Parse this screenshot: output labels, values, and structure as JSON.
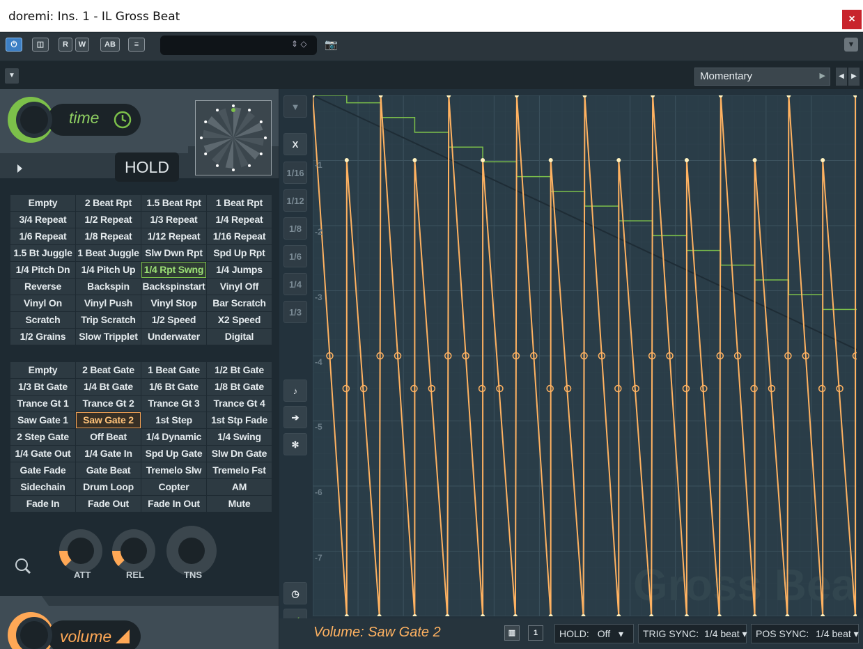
{
  "window": {
    "title": "doremi: Ins. 1 - IL Gross Beat",
    "close_glyph": "×"
  },
  "toolbar": {
    "buttons": [
      {
        "name": "power-button",
        "glyph": "⏻"
      },
      {
        "name": "window-button",
        "glyph": "◫"
      },
      {
        "name": "rec-button",
        "glyph": "R"
      },
      {
        "name": "wr-button",
        "glyph": "W"
      },
      {
        "name": "ab-button",
        "glyph": "AB"
      },
      {
        "name": "menu-button",
        "glyph": "≡"
      }
    ],
    "preset_value": "",
    "camera_glyph": "📷",
    "dropdown_glyph": "▼"
  },
  "subbar": {
    "dropdown_glyph": "▼",
    "mode": "Momentary",
    "prev": "◀",
    "next": "▶"
  },
  "time_panel": {
    "label": "time",
    "hold_label": "HOLD",
    "play_glyph": "▶"
  },
  "time_presets": [
    "Empty",
    "2 Beat Rpt",
    "1.5 Beat Rpt",
    "1 Beat Rpt",
    "3/4 Repeat",
    "1/2 Repeat",
    "1/3 Repeat",
    "1/4 Repeat",
    "1/6 Repeat",
    "1/8 Repeat",
    "1/12 Repeat",
    "1/16 Repeat",
    "1.5 Bt Juggle",
    "1 Beat Juggle",
    "Slw Dwn Rpt",
    "Spd Up Rpt",
    "1/4 Pitch Dn",
    "1/4 Pitch Up",
    "1/4 Rpt Swng",
    "1/4 Jumps",
    "Reverse",
    "Backspin",
    "Backspinstart",
    "Vinyl Off",
    "Vinyl On",
    "Vinyl Push",
    "Vinyl Stop",
    "Bar Scratch",
    "Scratch",
    "Trip Scratch",
    "1/2 Speed",
    "X2 Speed",
    "1/2 Grains",
    "Slow Tripplet",
    "Underwater",
    "Digital"
  ],
  "time_selected": "1/4 Rpt Swng",
  "volume_presets": [
    "Empty",
    "2 Beat Gate",
    "1 Beat Gate",
    "1/2 Bt Gate",
    "1/3 Bt Gate",
    "1/4 Bt Gate",
    "1/6 Bt Gate",
    "1/8 Bt Gate",
    "Trance Gt 1",
    "Trance Gt 2",
    "Trance Gt 3",
    "Trance Gt 4",
    "Saw Gate 1",
    "Saw Gate 2",
    "1st Step",
    "1st Stp Fade",
    "2 Step Gate",
    "Off Beat",
    "1/4 Dynamic",
    "1/4 Swing",
    "1/4 Gate Out",
    "1/4 Gate In",
    "Spd Up Gate",
    "Slw Dn Gate",
    "Gate Fade",
    "Gate Beat",
    "Tremelo Slw",
    "Tremelo Fst",
    "Sidechain",
    "Drum Loop",
    "Copter",
    "AM",
    "Fade In",
    "Fade Out",
    "Fade In Out",
    "Mute"
  ],
  "volume_selected": "Saw Gate 2",
  "knobs": [
    {
      "label": "ATT",
      "level": 0.25
    },
    {
      "label": "REL",
      "level": 0.25
    },
    {
      "label": "TNS",
      "level": 0.0
    }
  ],
  "volume_panel": {
    "label": "volume"
  },
  "side_buttons": [
    "X",
    "1/16",
    "1/12",
    "1/8",
    "1/6",
    "1/4",
    "1/3"
  ],
  "y_labels": [
    "-1",
    "-2",
    "-3",
    "-4",
    "-5",
    "-6",
    "-7"
  ],
  "watermark": "Gross Beat",
  "status": {
    "volume_label": "Volume: Saw Gate 2",
    "piano_glyph": "▥",
    "one_label": "1",
    "hold_label": "HOLD:",
    "hold_value": "Off",
    "trig_label": "TRIG SYNC:",
    "trig_value": "1/4 beat",
    "pos_label": "POS SYNC:",
    "pos_value": "1/4 beat",
    "dd": "▾"
  },
  "colors": {
    "accent_time": "#7cc04a",
    "accent_volume": "#ffa856"
  }
}
